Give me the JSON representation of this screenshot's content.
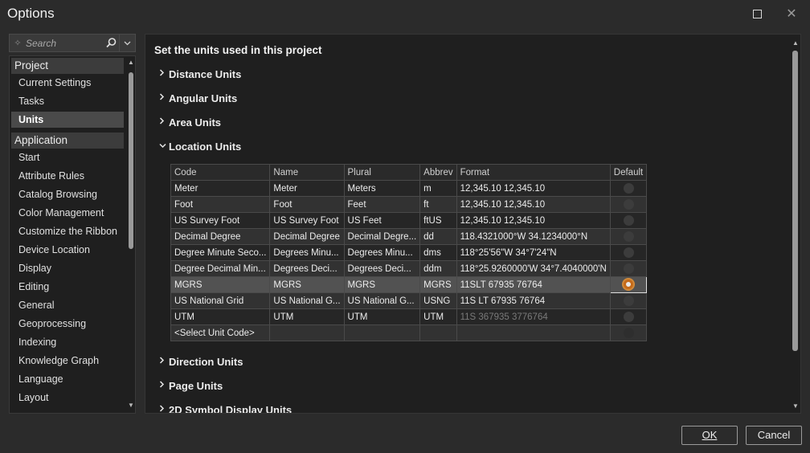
{
  "window": {
    "title": "Options"
  },
  "search": {
    "placeholder": "Search",
    "icon": "sparkle-icon",
    "search_icon": "magnifier-icon",
    "dropdown_icon": "chevron-down-icon"
  },
  "nav": {
    "groups": [
      {
        "label": "Project",
        "items": [
          "Current Settings",
          "Tasks",
          "Units"
        ]
      },
      {
        "label": "Application",
        "items": [
          "Start",
          "Attribute Rules",
          "Catalog Browsing",
          "Color Management",
          "Customize the Ribbon",
          "Device Location",
          "Display",
          "Editing",
          "General",
          "Geoprocessing",
          "Indexing",
          "Knowledge Graph",
          "Language",
          "Layout"
        ]
      }
    ],
    "selected": "Units"
  },
  "content": {
    "title": "Set the units used in this project",
    "sections_before": [
      "Distance Units",
      "Angular Units",
      "Area Units",
      "Location Units"
    ],
    "sections_after": [
      "Direction Units",
      "Page Units",
      "2D Symbol Display Units"
    ],
    "expanded": "Location Units"
  },
  "grid": {
    "columns": [
      "Code",
      "Name",
      "Plural",
      "Abbrev",
      "Format",
      "Default"
    ],
    "rows": [
      {
        "code": "Meter",
        "name": "Meter",
        "plural": "Meters",
        "abbrev": "m",
        "format": "12,345.10 12,345.10"
      },
      {
        "code": "Foot",
        "name": "Foot",
        "plural": "Feet",
        "abbrev": "ft",
        "format": "12,345.10 12,345.10"
      },
      {
        "code": "US Survey Foot",
        "name": "US Survey Foot",
        "plural": "US Feet",
        "abbrev": "ftUS",
        "format": "12,345.10 12,345.10"
      },
      {
        "code": "Decimal Degree",
        "name": "Decimal Degree",
        "plural": "Decimal Degre...",
        "abbrev": "dd",
        "format": "118.4321000°W 34.1234000°N"
      },
      {
        "code": "Degree Minute Seco...",
        "name": "Degrees Minu...",
        "plural": "Degrees Minu...",
        "abbrev": "dms",
        "format": "118°25'56\"W 34°7'24\"N"
      },
      {
        "code": "Degree Decimal Min...",
        "name": "Degrees Deci...",
        "plural": "Degrees Deci...",
        "abbrev": "ddm",
        "format": "118°25.9260000'W 34°7.4040000'N"
      },
      {
        "code": "MGRS",
        "name": "MGRS",
        "plural": "MGRS",
        "abbrev": "MGRS",
        "format": "11SLT 67935 76764"
      },
      {
        "code": "US National Grid",
        "name": "US National G...",
        "plural": "US National G...",
        "abbrev": "USNG",
        "format": "11S LT 67935 76764"
      },
      {
        "code": "UTM",
        "name": "UTM",
        "plural": "UTM",
        "abbrev": "UTM",
        "format": "11S 367935 3776764"
      },
      {
        "code": "<Select Unit Code>",
        "name": "",
        "plural": "",
        "abbrev": "",
        "format": ""
      }
    ],
    "default_row": "MGRS"
  },
  "buttons": {
    "ok": "OK",
    "cancel": "Cancel"
  }
}
